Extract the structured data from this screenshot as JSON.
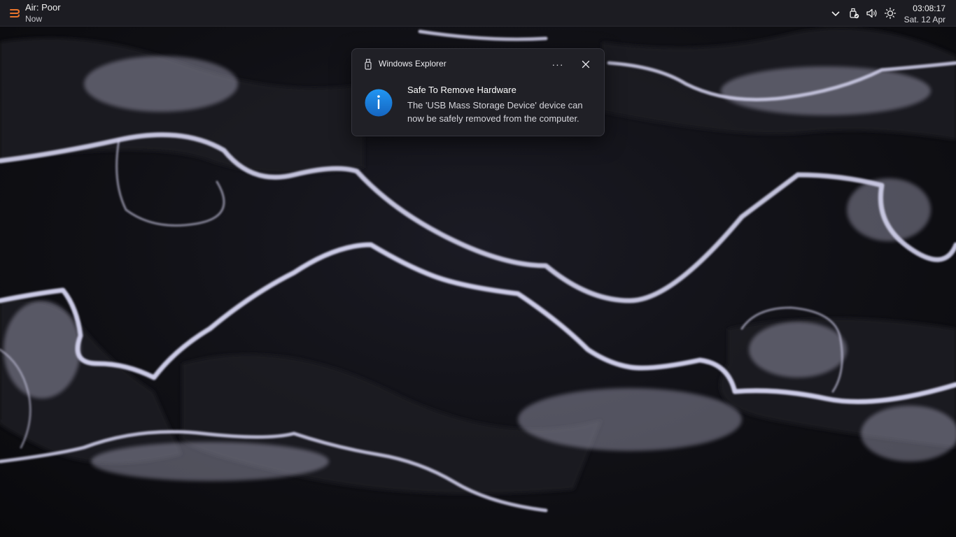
{
  "weather": {
    "title": "Air: Poor",
    "subtitle": "Now",
    "icon": "air-quality-icon",
    "icon_color": "#e8742c"
  },
  "tray": {
    "icons": [
      "chevron-up-icon",
      "usb-eject-icon",
      "volume-icon",
      "brightness-icon"
    ]
  },
  "clock": {
    "time": "03:08:17",
    "date": "Sat. 12 Apr"
  },
  "toast": {
    "app_name": "Windows Explorer",
    "title": "Safe To Remove Hardware",
    "body": "The 'USB Mass Storage Device' device can now be safely removed from the computer.",
    "more_label": "···",
    "info_icon": "info-icon",
    "accent": "#1e88e5"
  }
}
